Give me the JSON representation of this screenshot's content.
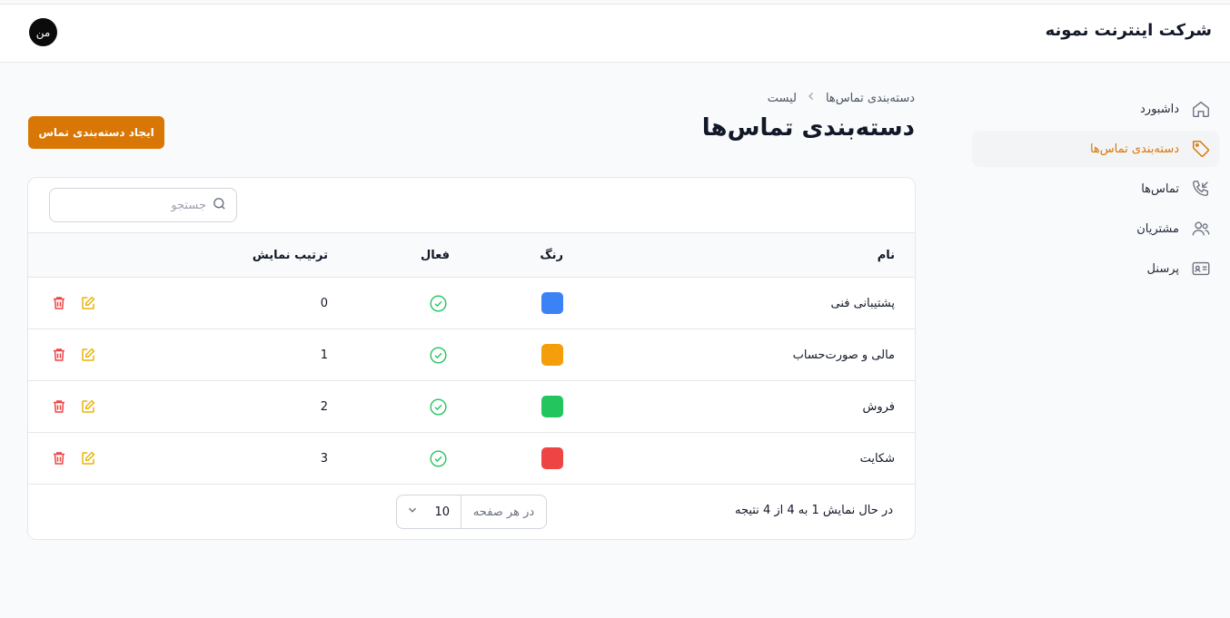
{
  "header": {
    "brand": "شرکت اینترنت نمونه",
    "avatar_initials": "من"
  },
  "sidebar": {
    "items": [
      {
        "label": "داشبورد",
        "icon": "home-icon",
        "active": false
      },
      {
        "label": "دسته‌بندی تماس‌ها",
        "icon": "tag-icon",
        "active": true
      },
      {
        "label": "تماس‌ها",
        "icon": "phone-incoming-icon",
        "active": false
      },
      {
        "label": "مشتریان",
        "icon": "users-icon",
        "active": false
      },
      {
        "label": "پرسنل",
        "icon": "id-card-icon",
        "active": false
      }
    ]
  },
  "breadcrumb": {
    "parent": "دسته‌بندی تماس‌ها",
    "current": "لیست"
  },
  "page": {
    "title": "دسته‌بندی تماس‌ها",
    "create_label": "ایجاد دسته‌بندی تماس"
  },
  "search": {
    "placeholder": "جستجو",
    "value": ""
  },
  "table": {
    "columns": {
      "name": "نام",
      "color": "رنگ",
      "active": "فعال",
      "order": "ترتیب نمایش"
    },
    "rows": [
      {
        "name": "پشتیبانی فنی",
        "color": "#3b82f6",
        "active": true,
        "order": "0"
      },
      {
        "name": "مالی و صورت‌حساب",
        "color": "#f59e0b",
        "active": true,
        "order": "1"
      },
      {
        "name": "فروش",
        "color": "#22c55e",
        "active": true,
        "order": "2"
      },
      {
        "name": "شکایت",
        "color": "#ef4444",
        "active": true,
        "order": "3"
      }
    ]
  },
  "footer": {
    "summary": "در حال نمایش 1 به 4 از 4 نتیجه",
    "per_page_label": "در هر صفحه",
    "per_page_value": "10"
  },
  "colors": {
    "accent": "#d97706",
    "success": "#22c55e",
    "danger": "#ef4444",
    "edit": "#eab308"
  }
}
